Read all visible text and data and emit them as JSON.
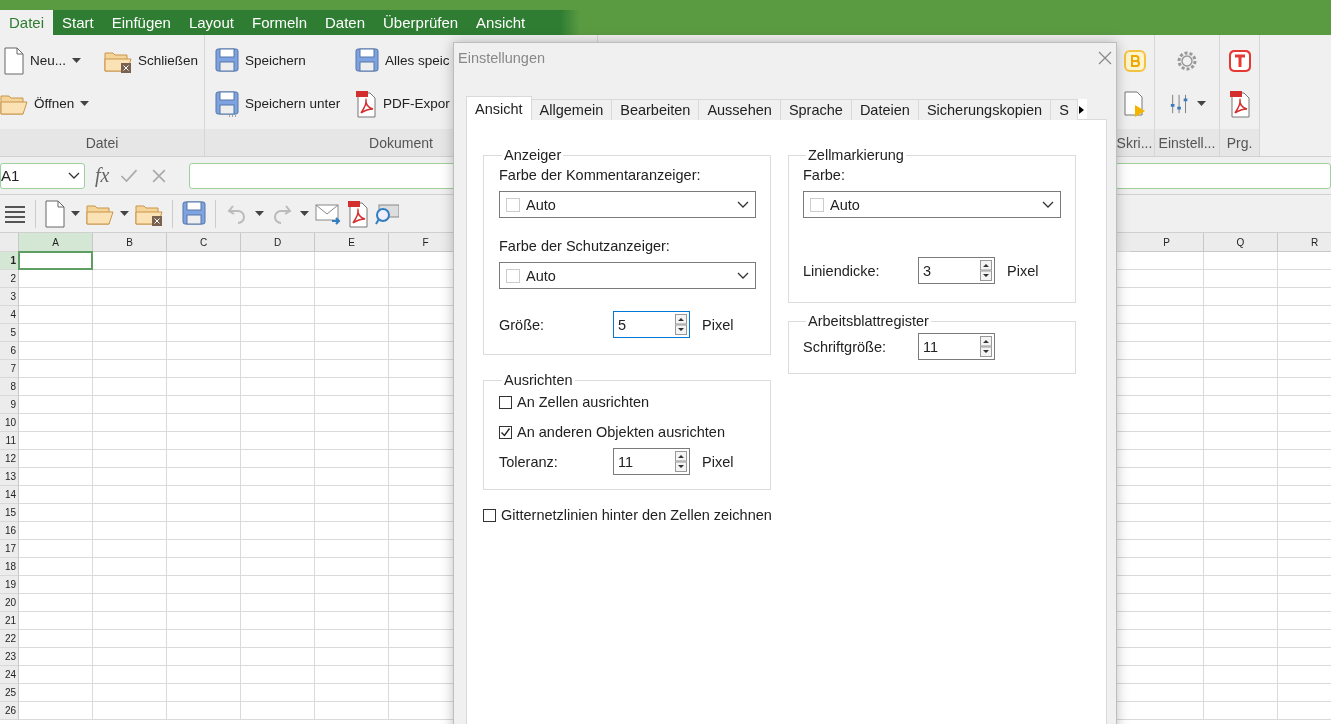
{
  "menu_tabs": [
    {
      "label": "Datei",
      "selected": true
    },
    {
      "label": "Start",
      "selected": false
    },
    {
      "label": "Einfügen",
      "selected": false
    },
    {
      "label": "Layout",
      "selected": false
    },
    {
      "label": "Formeln",
      "selected": false
    },
    {
      "label": "Daten",
      "selected": false
    },
    {
      "label": "Überprüfen",
      "selected": false
    },
    {
      "label": "Ansicht",
      "selected": false
    }
  ],
  "ribbon_left": [
    {
      "label": "Datei",
      "items": [
        {
          "label": "Neu...",
          "dropdown": true
        },
        {
          "label": "Schließen",
          "dropdown": false
        },
        {
          "label": "Öffnen",
          "dropdown": true
        }
      ]
    },
    {
      "label": "Dokument",
      "items": [
        {
          "label": "Speichern",
          "dropdown": false
        },
        {
          "label": "Alles speic"
        },
        {
          "label": "Speichern unter",
          "dropdown": false
        },
        {
          "label": "PDF-Expor"
        }
      ]
    }
  ],
  "ribbon_right": [
    {
      "label": "Skri..."
    },
    {
      "label": "Einstell..."
    },
    {
      "label": "Prg."
    }
  ],
  "formula_bar": {
    "cell": "A1",
    "fx": "fx"
  },
  "grid": {
    "columns": [
      {
        "label": "A",
        "selected": true
      },
      {
        "label": "B",
        "selected": false
      },
      {
        "label": "C",
        "selected": false
      },
      {
        "label": "D",
        "selected": false
      },
      {
        "label": "E",
        "selected": false
      },
      {
        "label": "F",
        "selected": false
      }
    ],
    "right_columns": [
      {
        "label": "P",
        "selected": false
      },
      {
        "label": "Q",
        "selected": false
      },
      {
        "label": "R",
        "selected": false
      }
    ],
    "rows": [
      {
        "label": "1",
        "selected": true
      },
      {
        "label": "2",
        "selected": false
      },
      {
        "label": "3",
        "selected": false
      },
      {
        "label": "4",
        "selected": false
      },
      {
        "label": "5",
        "selected": false
      },
      {
        "label": "6",
        "selected": false
      },
      {
        "label": "7",
        "selected": false
      },
      {
        "label": "8",
        "selected": false
      },
      {
        "label": "9",
        "selected": false
      },
      {
        "label": "10",
        "selected": false
      },
      {
        "label": "11",
        "selected": false
      },
      {
        "label": "12",
        "selected": false
      },
      {
        "label": "13",
        "selected": false
      },
      {
        "label": "14",
        "selected": false
      },
      {
        "label": "15",
        "selected": false
      },
      {
        "label": "16",
        "selected": false
      },
      {
        "label": "17",
        "selected": false
      },
      {
        "label": "18",
        "selected": false
      },
      {
        "label": "19",
        "selected": false
      },
      {
        "label": "20",
        "selected": false
      },
      {
        "label": "21",
        "selected": false
      },
      {
        "label": "22",
        "selected": false
      },
      {
        "label": "23",
        "selected": false
      },
      {
        "label": "24",
        "selected": false
      },
      {
        "label": "25",
        "selected": false
      },
      {
        "label": "26",
        "selected": false
      }
    ]
  },
  "dialog": {
    "title": "Einstellungen",
    "tabs": [
      {
        "label": "Ansicht",
        "selected": true
      },
      {
        "label": "Allgemein",
        "selected": false
      },
      {
        "label": "Bearbeiten",
        "selected": false
      },
      {
        "label": "Aussehen",
        "selected": false
      },
      {
        "label": "Sprache",
        "selected": false
      },
      {
        "label": "Dateien",
        "selected": false
      },
      {
        "label": "Sicherungskopien",
        "selected": false
      },
      {
        "label": "S",
        "selected": false
      }
    ],
    "anzeiger": {
      "title": "Anzeiger",
      "comment_color_label": "Farbe der Kommentaranzeiger:",
      "comment_choice": "Auto",
      "protect_color_label": "Farbe der Schutzanzeiger:",
      "protect_choice": "Auto",
      "size_label": "Größe:",
      "size": "5",
      "size_unit": "Pixel"
    },
    "ausrichten": {
      "title": "Ausrichten",
      "checks": [
        {
          "label": "An Zellen ausrichten",
          "checked": false
        },
        {
          "label": "An anderen Objekten ausrichten",
          "checked": true
        }
      ],
      "tolerance_label": "Toleranz:",
      "tolerance": "11",
      "tolerance_unit": "Pixel"
    },
    "gridlines": {
      "label": "Gitternetzlinien hinter den Zellen zeichnen",
      "checked": false
    },
    "zellmarkierung": {
      "title": "Zellmarkierung",
      "color_label": "Farbe:",
      "choice": "Auto",
      "thickness_label": "Liniendicke:",
      "thickness": "3",
      "thickness_unit": "Pixel"
    },
    "register": {
      "title": "Arbeitsblattregister",
      "font_size_label": "Schriftgröße:",
      "font_size": "11"
    }
  }
}
